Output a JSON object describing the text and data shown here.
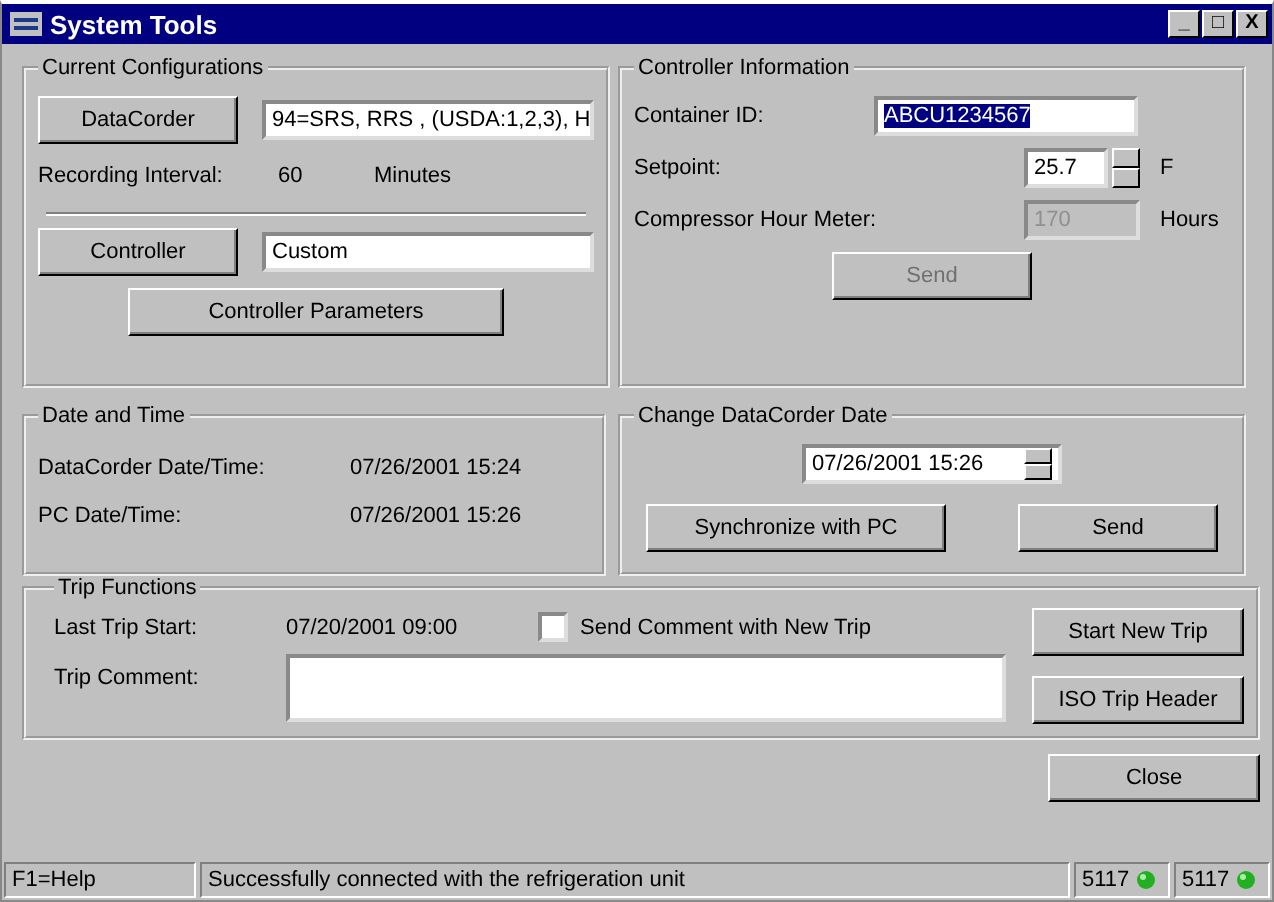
{
  "window": {
    "title": "System Tools",
    "controls": [
      "_",
      "□",
      "X"
    ]
  },
  "current_configurations": {
    "title": "Current Configurations",
    "datacorder_button": "DataCorder",
    "datacorder_value": "94=SRS, RRS , (USDA:1,2,3), H",
    "interval_label": "Recording Interval:",
    "interval_value": "60",
    "interval_unit": "Minutes",
    "controller_button": "Controller",
    "controller_value": "Custom",
    "parameters_button": "Controller Parameters"
  },
  "date_time": {
    "title": "Date and Time",
    "rows": [
      {
        "label": "DataCorder Date/Time:",
        "value": "07/26/2001 15:24"
      },
      {
        "label": "PC Date/Time:",
        "value": "07/26/2001 15:26"
      }
    ]
  },
  "controller_information": {
    "title": "Controller Information",
    "container_id_label": "Container ID:",
    "container_id_value": "ABCU1234567",
    "container_id_highlighted": true,
    "setpoint_label": "Setpoint:",
    "setpoint_value": "25.7",
    "setpoint_unit": "F",
    "hour_meter_label": "Compressor Hour Meter:",
    "hour_meter_value": "170",
    "hour_meter_disabled": true,
    "hour_meter_unit": "Hours",
    "send_button": {
      "label": "Send",
      "disabled": true
    }
  },
  "change_date": {
    "title": "Change DataCorder Date",
    "date_value": "07/26/2001 15:26",
    "sync_button": "Synchronize with PC",
    "send_button": "Send"
  },
  "trip_functions": {
    "title": "Trip Functions",
    "last_trip_label": "Last Trip Start:",
    "last_trip_value": "07/20/2001 09:00",
    "comment_checkbox": {
      "label": "Send Comment with New Trip",
      "checked": false
    },
    "comment_label": "Trip Comment:",
    "start_button": "Start New Trip",
    "iso_button": "ISO Trip Header"
  },
  "close_button": "Close",
  "status_bar": {
    "help": "F1=Help",
    "message": "Successfully connected with the refrigeration unit",
    "ports": [
      {
        "text": "5117"
      },
      {
        "text": "5117"
      }
    ]
  }
}
